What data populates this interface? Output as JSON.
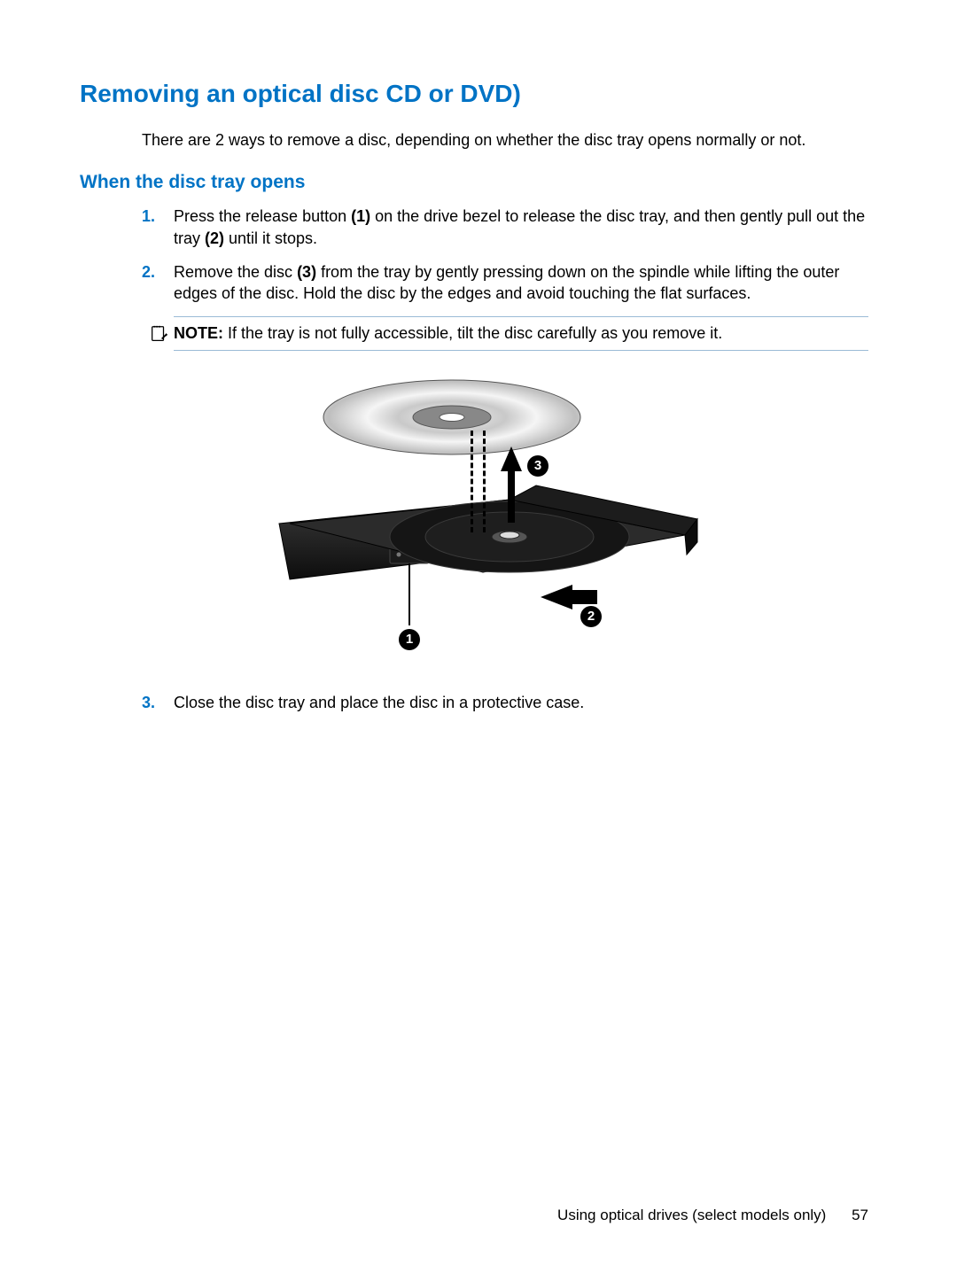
{
  "title": "Removing an optical disc CD or DVD)",
  "intro": "There are 2 ways to remove a disc, depending on whether the disc tray opens normally or not.",
  "subtitle": "When the disc tray opens",
  "steps": [
    {
      "num": "1.",
      "pre": "Press the release button ",
      "b1": "(1)",
      "mid": " on the drive bezel to release the disc tray, and then gently pull out the tray ",
      "b2": "(2)",
      "post": " until it stops."
    },
    {
      "num": "2.",
      "pre": "Remove the disc ",
      "b1": "(3)",
      "mid": " from the tray by gently pressing down on the spindle while lifting the outer edges of the disc. Hold the disc by the edges and avoid touching the flat surfaces.",
      "b2": "",
      "post": ""
    }
  ],
  "note": {
    "label": "NOTE:",
    "text": " If the tray is not fully accessible, tilt the disc carefully as you remove it."
  },
  "step3": {
    "num": "3.",
    "text": "Close the disc tray and place the disc in a protective case."
  },
  "figure": {
    "c1": "1",
    "c2": "2",
    "c3": "3"
  },
  "footer": {
    "section": "Using optical drives (select models only)",
    "page": "57"
  }
}
